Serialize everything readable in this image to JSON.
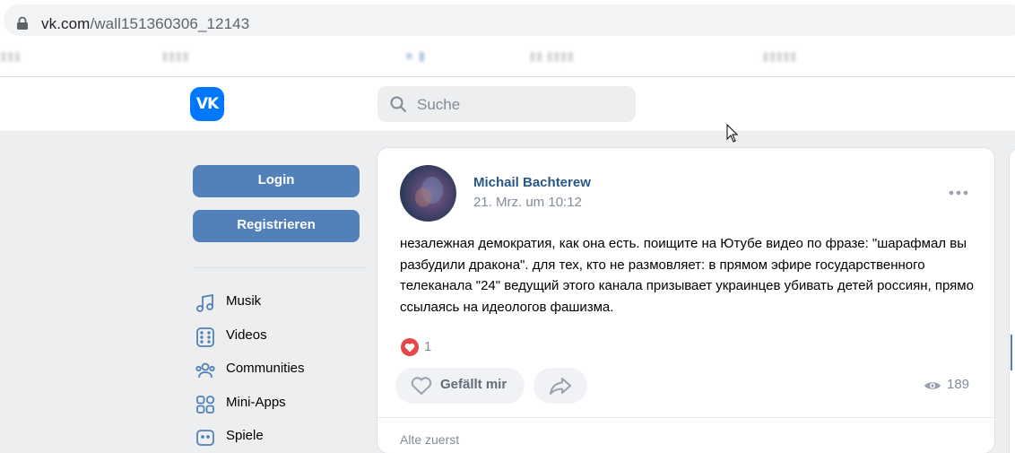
{
  "browser": {
    "url_domain": "vk.com",
    "url_path": "/wall151360306_12143"
  },
  "header": {
    "logo_text": "VK",
    "search_placeholder": "Suche"
  },
  "sidebar": {
    "login_label": "Login",
    "register_label": "Registrieren",
    "items": [
      {
        "label": "Musik",
        "icon": "music-icon"
      },
      {
        "label": "Videos",
        "icon": "video-icon"
      },
      {
        "label": "Communities",
        "icon": "communities-icon"
      },
      {
        "label": "Mini-Apps",
        "icon": "mini-apps-icon"
      },
      {
        "label": "Spiele",
        "icon": "games-icon"
      }
    ]
  },
  "post": {
    "author": "Michail Bachterew",
    "date": "21. Mrz. um 10:12",
    "text": "незалежная демократия, как она есть. поищите на Ютубе видео по фразе: \"шарафмал вы разбудили дракона\". для тех, кто не размовляет: в прямом эфире государственного телеканала \"24\" ведущий этого канала призывает украинцев убивать детей россиян, прямо ссылаясь на идеологов фашизма.",
    "reactions_count": "1",
    "like_label": "Gefällt mir",
    "views_count": "189",
    "sort_label": "Alte zuerst"
  },
  "colors": {
    "brand": "#0077ff",
    "button": "#5181b8",
    "link": "#2a5885",
    "background": "#edeef0",
    "reaction": "#e64646"
  }
}
